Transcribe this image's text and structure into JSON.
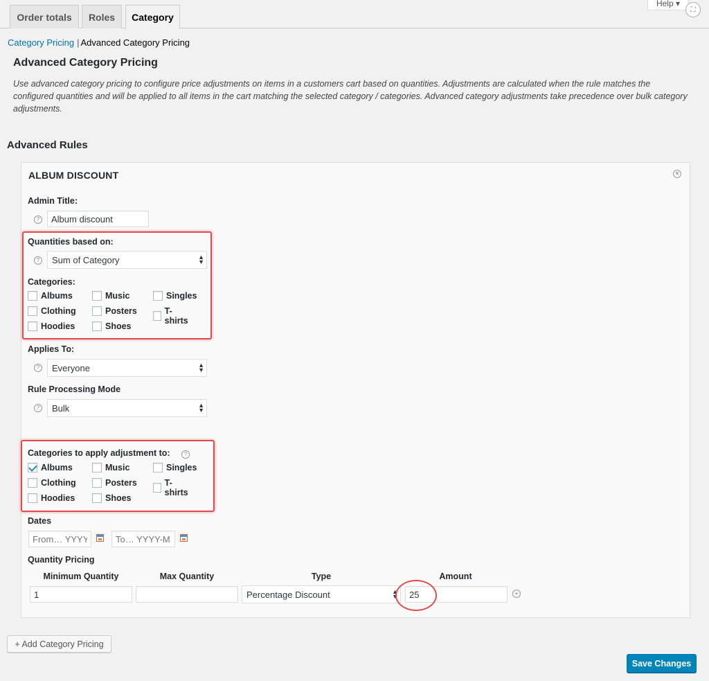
{
  "tabs": [
    {
      "label": "Order totals"
    },
    {
      "label": "Roles"
    },
    {
      "label": "Category",
      "active": true
    }
  ],
  "help": {
    "label": "Help"
  },
  "subnav": {
    "link": "Category Pricing",
    "separator": "|",
    "current": "Advanced Category Pricing"
  },
  "page": {
    "title": "Advanced Category Pricing",
    "description": "Use advanced category pricing to configure price adjustments on items in a customers cart based on quantities. Adjustments are calculated when the rule matches the configured quantities and will be applied to all items in the cart matching the selected category / categories. Advanced category adjustments take precedence over bulk category adjustments.",
    "rules_heading": "Advanced Rules"
  },
  "rule": {
    "title": "ALBUM DISCOUNT",
    "admin_title_label": "Admin Title:",
    "admin_title_value": "Album discount",
    "quantities_label": "Quantities based on:",
    "quantities_value": "Sum of Category",
    "categories_label": "Categories:",
    "categories": [
      {
        "label": "Albums",
        "checked": false
      },
      {
        "label": "Music",
        "checked": false
      },
      {
        "label": "Singles",
        "checked": false
      },
      {
        "label": "Clothing",
        "checked": false
      },
      {
        "label": "Posters",
        "checked": false
      },
      {
        "label": "T-shirts",
        "checked": false
      },
      {
        "label": "Hoodies",
        "checked": false
      },
      {
        "label": "Shoes",
        "checked": false
      }
    ],
    "applies_to_label": "Applies To:",
    "applies_to_value": "Everyone",
    "mode_label": "Rule Processing Mode",
    "mode_value": "Bulk",
    "apply_categories_label": "Categories to apply adjustment to:",
    "apply_categories": [
      {
        "label": "Albums",
        "checked": true
      },
      {
        "label": "Music",
        "checked": false
      },
      {
        "label": "Singles",
        "checked": false
      },
      {
        "label": "Clothing",
        "checked": false
      },
      {
        "label": "Posters",
        "checked": false
      },
      {
        "label": "T-shirts",
        "checked": false
      },
      {
        "label": "Hoodies",
        "checked": false
      },
      {
        "label": "Shoes",
        "checked": false
      }
    ],
    "dates_label": "Dates",
    "date_from_placeholder": "From… YYYY-",
    "date_to_placeholder": "To… YYYY-M",
    "quantity_pricing_label": "Quantity Pricing",
    "columns": {
      "min": "Minimum Quantity",
      "max": "Max Quantity",
      "type": "Type",
      "amount": "Amount"
    },
    "row": {
      "min": "1",
      "max": "",
      "type": "Percentage Discount",
      "amount": "25"
    }
  },
  "buttons": {
    "add": "+ Add Category Pricing",
    "save": "Save Changes"
  },
  "colors": {
    "accent": "#0085ba",
    "highlight": "#e04b4b",
    "link": "#0073aa"
  }
}
